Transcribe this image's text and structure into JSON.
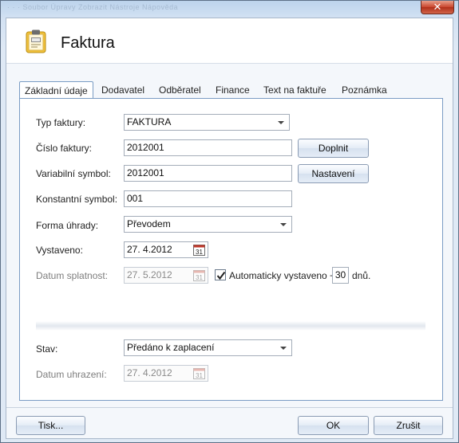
{
  "window": {
    "title": "Faktura",
    "ghost_title_text": "· · ·  Soubor   Úpravy   Zobrazit   Nástroje   Nápověda"
  },
  "tabs": [
    {
      "label": "Základní údaje"
    },
    {
      "label": "Dodavatel"
    },
    {
      "label": "Odběratel"
    },
    {
      "label": "Finance"
    },
    {
      "label": "Text na faktuře"
    },
    {
      "label": "Poznámka"
    }
  ],
  "form": {
    "typ_faktury": {
      "label": "Typ faktury:",
      "value": "FAKTURA"
    },
    "cislo_faktury": {
      "label": "Číslo faktury:",
      "value": "2012001",
      "button": "Doplnit"
    },
    "variabilni_symbol": {
      "label": "Variabilní symbol:",
      "value": "2012001",
      "button": "Nastavení"
    },
    "konstantni_symbol": {
      "label": "Konstantní symbol:",
      "value": "001"
    },
    "forma_uhrady": {
      "label": "Forma úhrady:",
      "value": "Převodem"
    },
    "vystaveno": {
      "label": "Vystaveno:",
      "value": "27. 4.2012"
    },
    "datum_splatnost": {
      "label": "Datum splatnost:",
      "value": "27. 5.2012",
      "auto_label": "Automaticky vystaveno +",
      "days": "30",
      "days_suffix": "dnů."
    },
    "stav": {
      "label": "Stav:",
      "value": "Předáno k zaplacení"
    },
    "datum_uhrazeni": {
      "label": "Datum uhrazení:",
      "value": "27. 4.2012"
    }
  },
  "footer": {
    "print": "Tisk...",
    "ok": "OK",
    "cancel": "Zrušit"
  },
  "colors": {
    "accent_border": "#7a9cc4",
    "close_button": "#c9452d"
  }
}
